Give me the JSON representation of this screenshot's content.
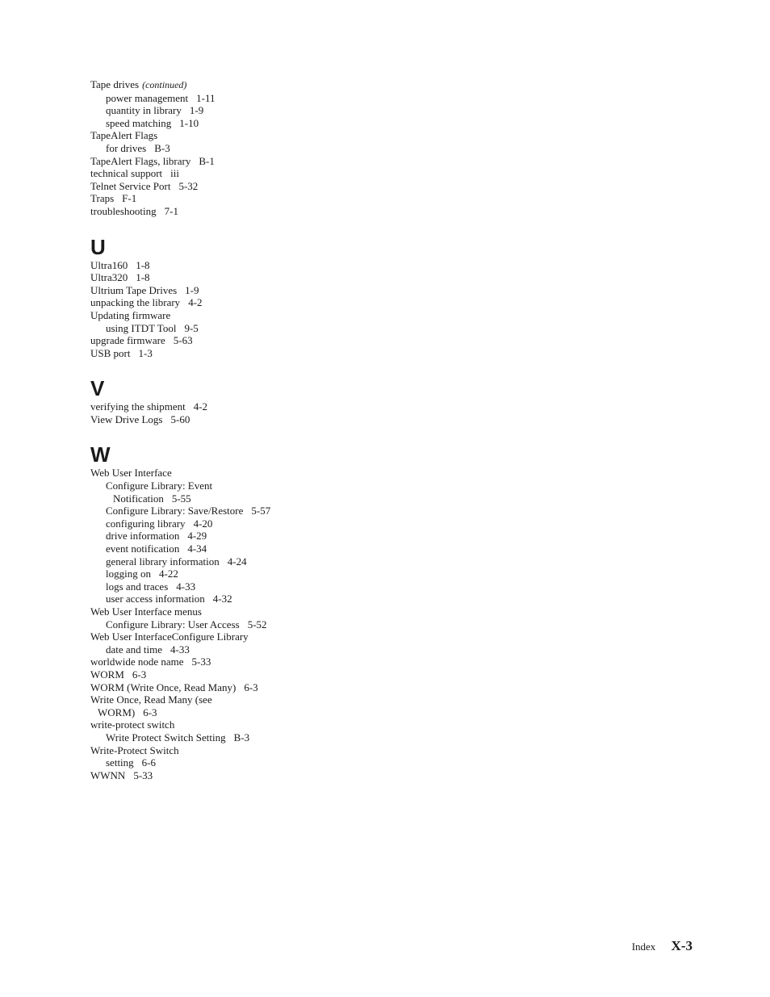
{
  "sections": [
    {
      "letter": "",
      "entries": [
        {
          "level": 1,
          "text": "Tape drives",
          "note": "(continued)",
          "page": ""
        },
        {
          "level": 2,
          "text": "power management",
          "page": "1-11"
        },
        {
          "level": 2,
          "text": "quantity in library",
          "page": "1-9"
        },
        {
          "level": 2,
          "text": "speed matching",
          "page": "1-10"
        },
        {
          "level": 1,
          "text": "TapeAlert Flags",
          "page": ""
        },
        {
          "level": 2,
          "text": "for drives",
          "page": "B-3"
        },
        {
          "level": 1,
          "text": "TapeAlert Flags, library",
          "page": "B-1"
        },
        {
          "level": 1,
          "text": "technical support",
          "page": "iii"
        },
        {
          "level": 1,
          "text": "Telnet Service Port",
          "page": "5-32"
        },
        {
          "level": 1,
          "text": "Traps",
          "page": "F-1"
        },
        {
          "level": 1,
          "text": "troubleshooting",
          "page": "7-1"
        }
      ]
    },
    {
      "letter": "U",
      "entries": [
        {
          "level": 1,
          "text": "Ultra160",
          "page": "1-8"
        },
        {
          "level": 1,
          "text": "Ultra320",
          "page": "1-8"
        },
        {
          "level": 1,
          "text": "Ultrium Tape Drives",
          "page": "1-9"
        },
        {
          "level": 1,
          "text": "unpacking the library",
          "page": "4-2"
        },
        {
          "level": 1,
          "text": "Updating firmware",
          "page": ""
        },
        {
          "level": 2,
          "text": "using ITDT Tool",
          "page": "9-5"
        },
        {
          "level": 1,
          "text": "upgrade firmware",
          "page": "5-63"
        },
        {
          "level": 1,
          "text": "USB port",
          "page": "1-3"
        }
      ]
    },
    {
      "letter": "V",
      "entries": [
        {
          "level": 1,
          "text": "verifying the shipment",
          "page": "4-2"
        },
        {
          "level": 1,
          "text": "View Drive Logs",
          "page": "5-60"
        }
      ]
    },
    {
      "letter": "W",
      "entries": [
        {
          "level": 1,
          "text": "Web User Interface",
          "page": ""
        },
        {
          "level": 2,
          "text": "Configure Library: Event",
          "page": ""
        },
        {
          "level": 3,
          "text": "Notification",
          "page": "5-55"
        },
        {
          "level": 2,
          "text": "Configure Library: Save/Restore",
          "page": "5-57"
        },
        {
          "level": 2,
          "text": "configuring library",
          "page": "4-20"
        },
        {
          "level": 2,
          "text": "drive information",
          "page": "4-29"
        },
        {
          "level": 2,
          "text": "event notification",
          "page": "4-34"
        },
        {
          "level": 2,
          "text": "general library information",
          "page": "4-24"
        },
        {
          "level": 2,
          "text": "logging on",
          "page": "4-22"
        },
        {
          "level": 2,
          "text": "logs and traces",
          "page": "4-33"
        },
        {
          "level": 2,
          "text": "user access information",
          "page": "4-32"
        },
        {
          "level": 1,
          "text": "Web User Interface menus",
          "page": ""
        },
        {
          "level": 2,
          "text": "Configure Library: User Access",
          "page": "5-52"
        },
        {
          "level": 1,
          "text": "Web User InterfaceConfigure Library",
          "page": ""
        },
        {
          "level": 2,
          "text": "date and time",
          "page": "4-33"
        },
        {
          "level": 1,
          "text": "worldwide node name",
          "page": "5-33"
        },
        {
          "level": 1,
          "text": "WORM",
          "page": "6-3"
        },
        {
          "level": 1,
          "text": "WORM (Write Once, Read Many)",
          "page": "6-3"
        },
        {
          "level": 1,
          "text": "Write Once, Read Many (see",
          "page": ""
        },
        {
          "level": 4,
          "text": "WORM)",
          "page": "6-3"
        },
        {
          "level": 1,
          "text": "write-protect switch",
          "page": ""
        },
        {
          "level": 2,
          "text": "Write Protect Switch Setting",
          "page": "B-3"
        },
        {
          "level": 1,
          "text": "Write-Protect Switch",
          "page": ""
        },
        {
          "level": 2,
          "text": "setting",
          "page": "6-6"
        },
        {
          "level": 1,
          "text": "WWNN",
          "page": "5-33"
        }
      ]
    }
  ],
  "footer": {
    "label": "Index",
    "page_number": "X-3"
  }
}
